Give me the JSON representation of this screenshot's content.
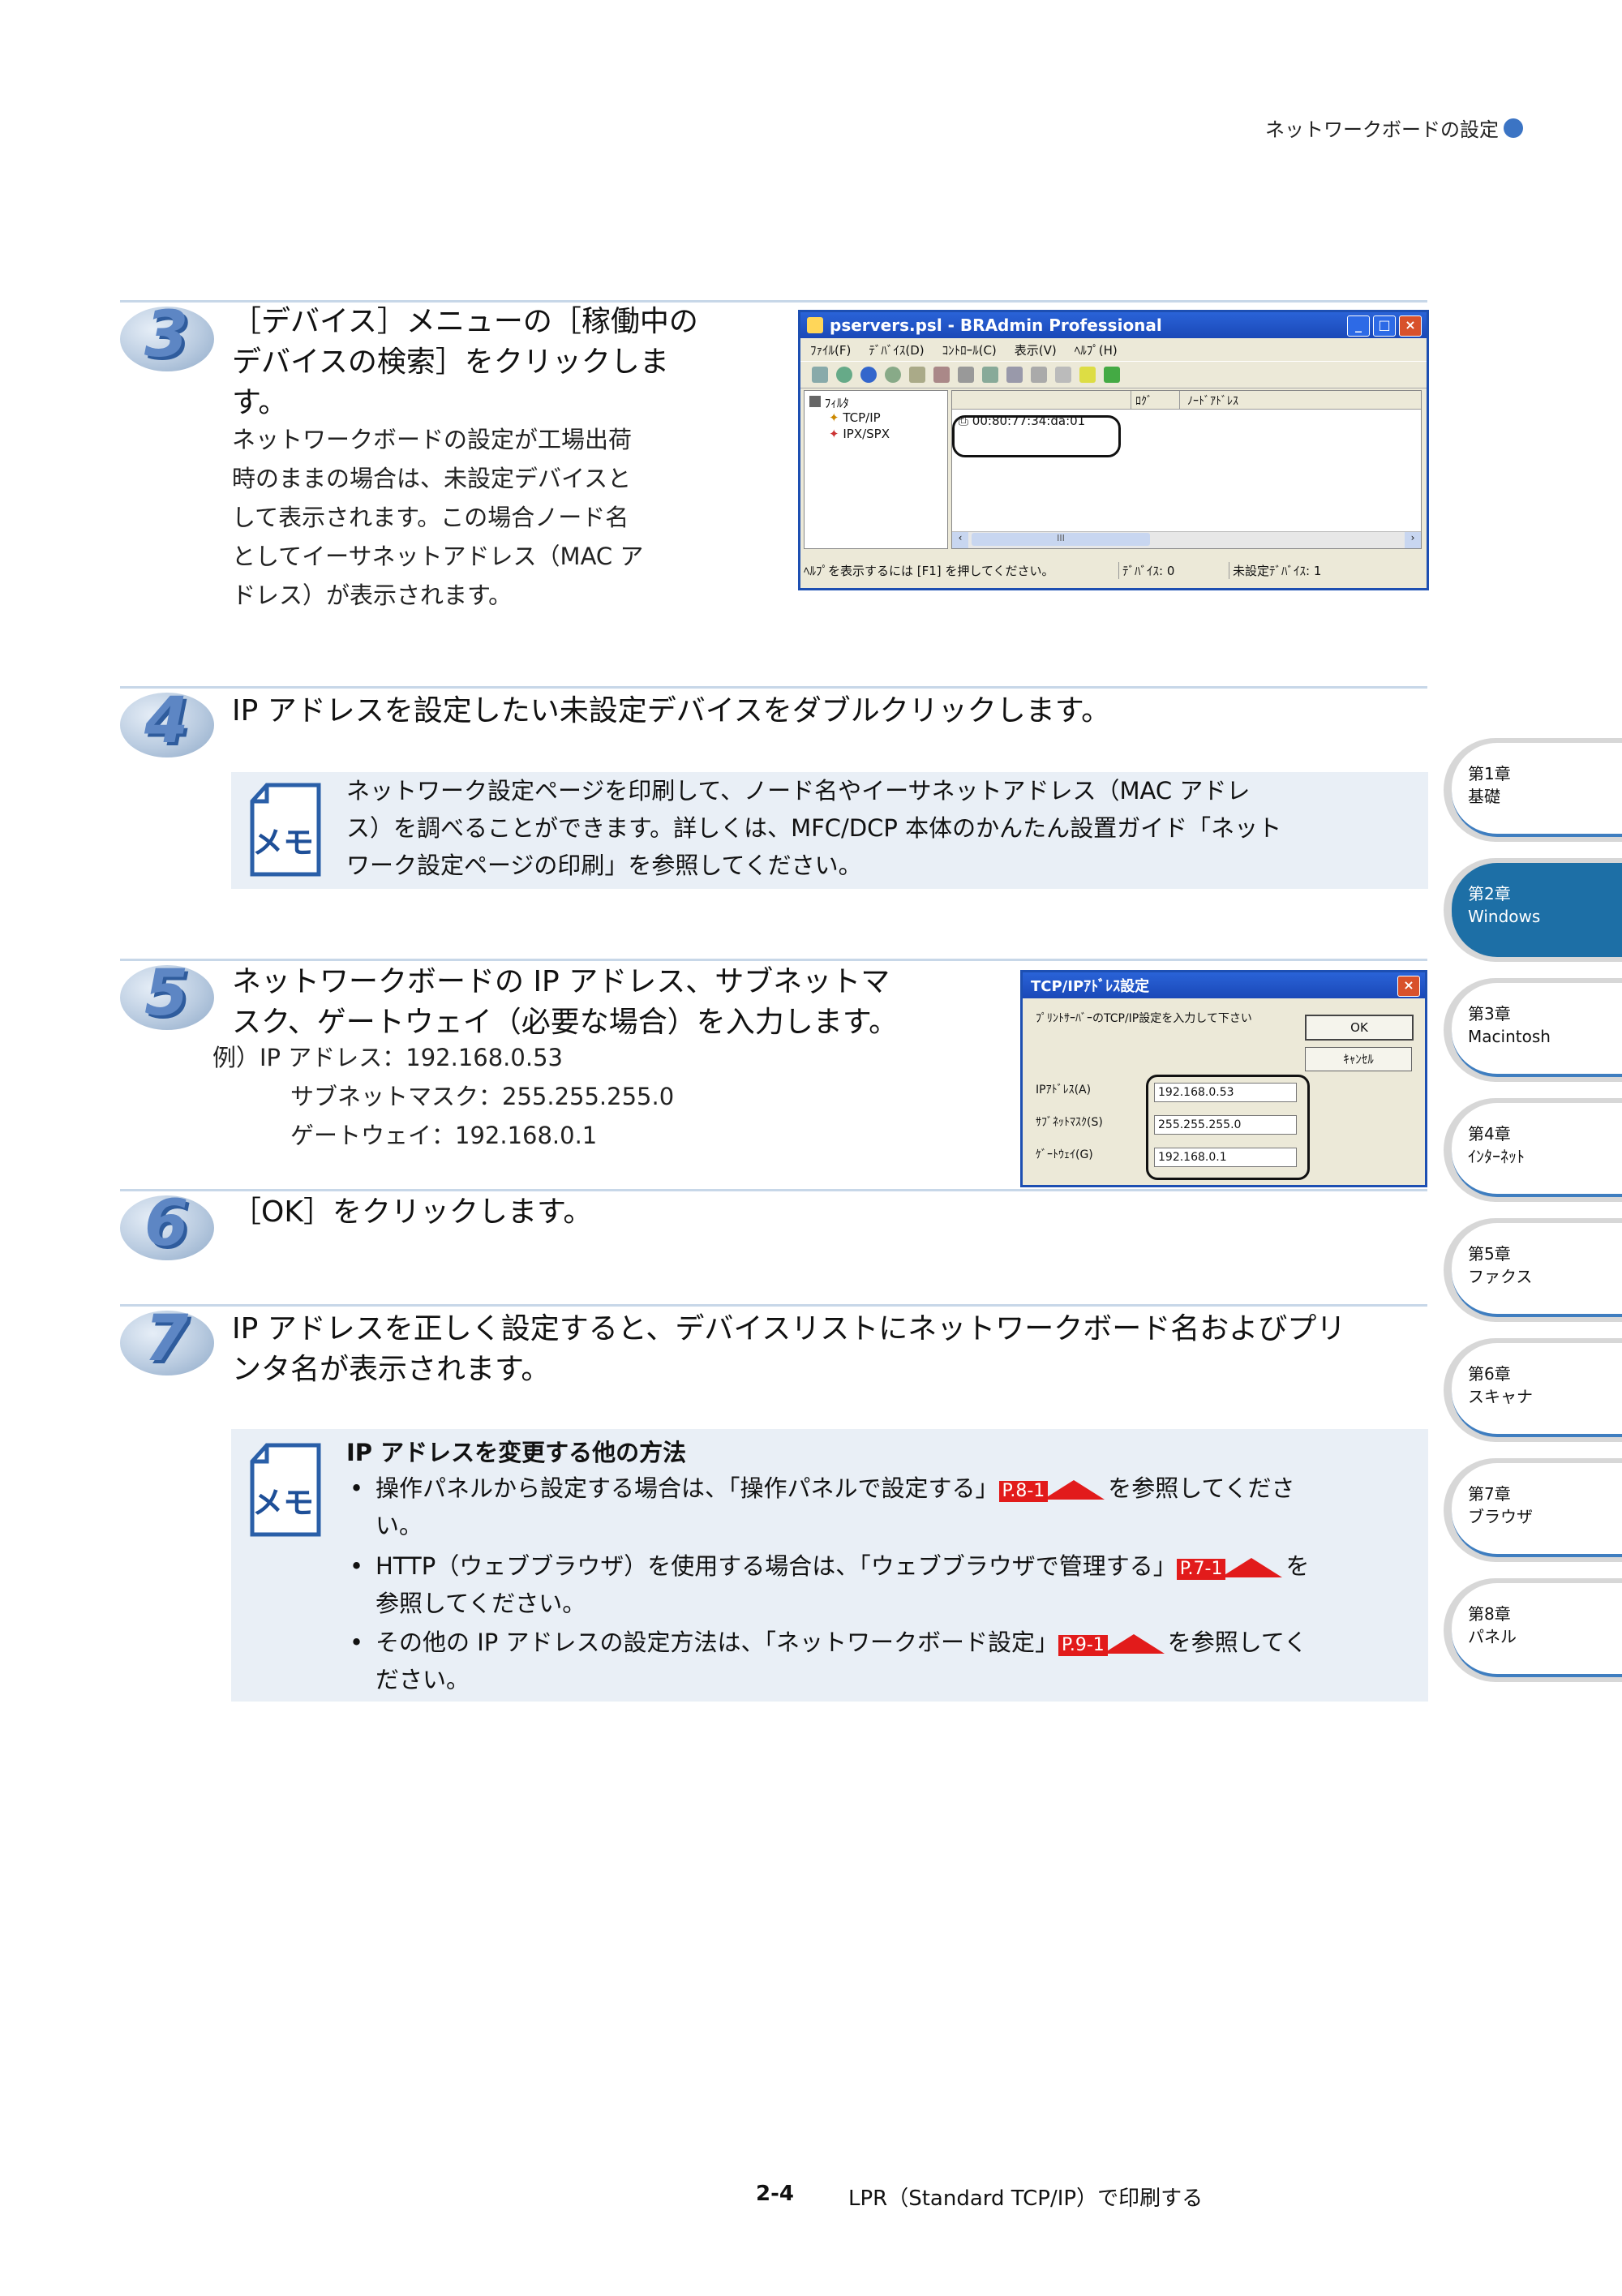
{
  "header": {
    "title": "ネットワークボードの設定"
  },
  "steps": [
    {
      "num": "3",
      "title_lines": [
        "［デバイス］メニューの［稼働中の",
        "デバイスの検索］をクリックしま",
        "す。"
      ],
      "body_lines": [
        "ネットワークボードの設定が工場出荷",
        "時のままの場合は、未設定デバイスと",
        "して表示されます。この場合ノード名",
        "としてイーサネットアドレス（MAC ア",
        "ドレス）が表示されます。"
      ]
    },
    {
      "num": "4",
      "title_lines": [
        "IP アドレスを設定したい未設定デバイスをダブルクリックします。"
      ]
    },
    {
      "num": "5",
      "title_lines": [
        "ネットワークボードの IP アドレス、サブネットマ",
        "スク、ゲートウェイ（必要な場合）を入力します。"
      ],
      "body_lines": [
        "例）IP アドレス：192.168.0.53",
        "サブネットマスク：255.255.255.0",
        "ゲートウェイ：192.168.0.1"
      ]
    },
    {
      "num": "6",
      "title_lines": [
        "［OK］をクリックします。"
      ]
    },
    {
      "num": "7",
      "title_lines": [
        "IP アドレスを正しく設定すると、デバイスリストにネットワークボード名およびプリ",
        "ンタ名が表示されます。"
      ]
    }
  ],
  "memo1": {
    "icon_label": "メモ",
    "lines": [
      "ネットワーク設定ページを印刷して、ノード名やイーサネットアドレス（MAC アドレ",
      "ス）を調べることができます。詳しくは、MFC/DCP 本体のかんたん設置ガイド「ネット",
      "ワーク設定ページの印刷」を参照してください。"
    ]
  },
  "memo2": {
    "icon_label": "メモ",
    "heading": "IP アドレスを変更する他の方法",
    "bullets": [
      {
        "before": "操作パネルから設定する場合は、「操作パネルで設定する」",
        "link": "P.8-1",
        "after": "を参照してくださ",
        "cont": "い。"
      },
      {
        "before": "HTTP（ウェブブラウザ）を使用する場合は、「ウェブブラウザで管理する」",
        "link": "P.7-1",
        "after": "を",
        "cont": "参照してください。"
      },
      {
        "before": "その他の IP アドレスの設定方法は、「ネットワークボード設定」",
        "link": "P.9-1",
        "after": "を参照してく",
        "cont": "ださい。"
      }
    ]
  },
  "window1": {
    "title": "pservers.psl - BRAdmin Professional",
    "menu": [
      "ﾌｧｲﾙ(F)",
      "ﾃﾞﾊﾞｲｽ(D)",
      "ｺﾝﾄﾛｰﾙ(C)",
      "表示(V)",
      "ﾍﾙﾌﾟ(H)"
    ],
    "tree_root": "ﾌｨﾙﾀ",
    "tree_items": [
      "TCP/IP",
      "IPX/SPX"
    ],
    "columns": [
      "ﾛｸﾞ",
      "ﾉｰﾄﾞｱﾄﾞﾚｽ"
    ],
    "device": "00:80:77:34:da:01",
    "scroll_label": "III",
    "status_help": "ﾍﾙﾌﾟを表示するには [F1] を押してください。",
    "status_devices": "ﾃﾞﾊﾞｲｽ: 0",
    "status_unset": "未設定ﾃﾞﾊﾞｲｽ: 1"
  },
  "window2": {
    "title": "TCP/IPｱﾄﾞﾚｽ設定",
    "prompt": "ﾌﾟﾘﾝﾄｻｰﾊﾞｰのTCP/IP設定を入力して下さい",
    "ok": "OK",
    "cancel": "ｷｬﾝｾﾙ",
    "ip_label": "IPｱﾄﾞﾚｽ(A)",
    "ip_value": "192.168.0.53",
    "mask_label": "ｻﾌﾞﾈｯﾄﾏｽｸ(S)",
    "mask_value": "255.255.255.0",
    "gw_label": "ｹﾞｰﾄｳｪｲ(G)",
    "gw_value": "192.168.0.1"
  },
  "tabs": [
    {
      "chapter": "第1章",
      "name": "基礎"
    },
    {
      "chapter": "第2章",
      "name": "Windows"
    },
    {
      "chapter": "第3章",
      "name": "Macintosh"
    },
    {
      "chapter": "第4章",
      "name": "ｲﾝﾀｰﾈｯﾄ"
    },
    {
      "chapter": "第5章",
      "name": "ファクス"
    },
    {
      "chapter": "第6章",
      "name": "スキャナ"
    },
    {
      "chapter": "第7章",
      "name": "ブラウザ"
    },
    {
      "chapter": "第8章",
      "name": "パネル"
    }
  ],
  "footer": {
    "page": "2-4",
    "title": "LPR（Standard TCP/IP）で印刷する"
  },
  "colors": {
    "accent": "#3b74c4",
    "active_tab": "#1d6fa6",
    "link_red": "#e21b1b",
    "memo_bg": "#e9eff6"
  }
}
